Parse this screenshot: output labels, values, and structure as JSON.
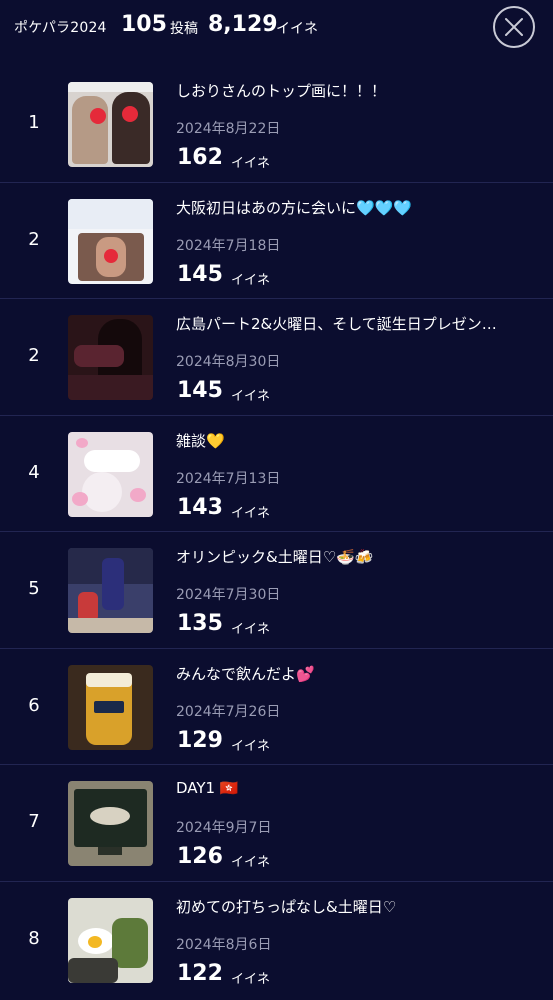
{
  "header": {
    "title": "ポケパラ2024",
    "posts_count": "105",
    "posts_label": "投稿",
    "likes_count": "8,129",
    "likes_label": "イイネ"
  },
  "posts": [
    {
      "rank": "1",
      "title": "しおりさんのトップ画に！！！",
      "date": "2024年8月22日",
      "likes": "162",
      "likes_label": "イイネ"
    },
    {
      "rank": "2",
      "title": "大阪初日はあの方に会いに🩵🩵🩵",
      "date": "2024年7月18日",
      "likes": "145",
      "likes_label": "イイネ"
    },
    {
      "rank": "2",
      "title": "広島パート2&火曜日、そして誕生日プレゼン…",
      "date": "2024年8月30日",
      "likes": "145",
      "likes_label": "イイネ"
    },
    {
      "rank": "4",
      "title": "雑談💛",
      "date": "2024年7月13日",
      "likes": "143",
      "likes_label": "イイネ"
    },
    {
      "rank": "5",
      "title": "オリンピック&土曜日♡🍜🍻",
      "date": "2024年7月30日",
      "likes": "135",
      "likes_label": "イイネ"
    },
    {
      "rank": "6",
      "title": "みんなで飲んだよ💕",
      "date": "2024年7月26日",
      "likes": "129",
      "likes_label": "イイネ"
    },
    {
      "rank": "7",
      "title": "DAY1 🇭🇰",
      "date": "2024年9月7日",
      "likes": "126",
      "likes_label": "イイネ"
    },
    {
      "rank": "8",
      "title": "初めての打ちっぱなし&土曜日♡",
      "date": "2024年8月6日",
      "likes": "122",
      "likes_label": "イイネ"
    }
  ],
  "colors": {
    "background": "#0b0d2f",
    "divider": "#222552",
    "date_text": "#9a9cb4",
    "close_border": "#c9cad6"
  },
  "icons": {
    "close": "close-icon"
  }
}
